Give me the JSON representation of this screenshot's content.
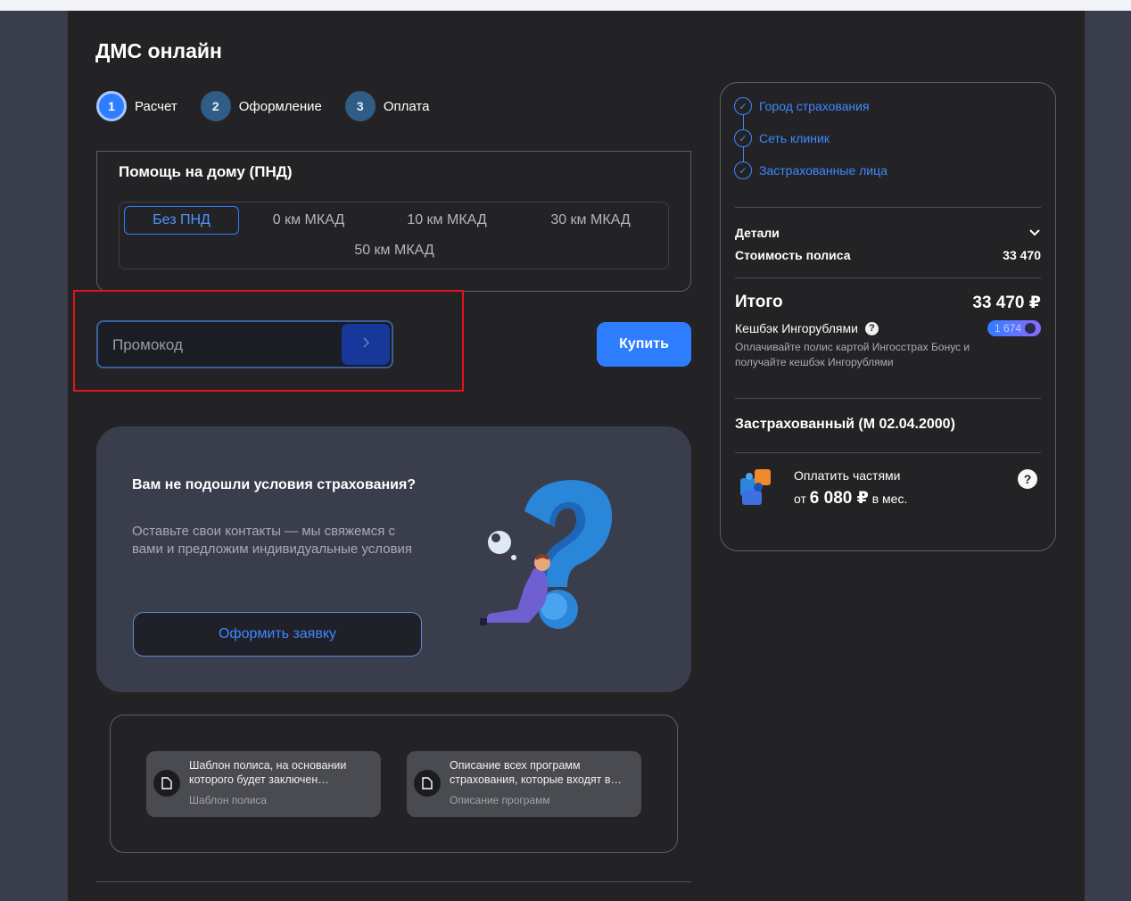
{
  "page": {
    "title": "ДМС онлайн"
  },
  "steps": [
    {
      "number": "1",
      "label": "Расчет",
      "active": true
    },
    {
      "number": "2",
      "label": "Оформление",
      "active": false
    },
    {
      "number": "3",
      "label": "Оплата",
      "active": false
    }
  ],
  "pnd": {
    "title": "Помощь на дому (ПНД)",
    "options": [
      "Без ПНД",
      "0 км МКАД",
      "10 км МКАД",
      "30 км МКАД",
      "50 км МКАД"
    ],
    "selected": "Без ПНД"
  },
  "promo": {
    "placeholder": "Промокод",
    "submit_icon": "chevron-right-icon"
  },
  "buy_button": "Купить",
  "help_card": {
    "title": "Вам не подошли условия страхования?",
    "text": "Оставьте свои контакты — мы свяжемся с вами и предложим индивидуальные условия",
    "button": "Оформить заявку"
  },
  "docs": [
    {
      "title": "Шаблон полиса, на основании которого будет заключен…",
      "subtitle": "Шаблон полиса"
    },
    {
      "title": "Описание всех программ страхования, которые входят в…",
      "subtitle": "Описание программ"
    }
  ],
  "summary": {
    "checklist": [
      "Город страхования",
      "Сеть клиник",
      "Застрахованные лица"
    ],
    "details_label": "Детали",
    "cost_label": "Стоимость полиса",
    "cost_value": "33 470",
    "total_label": "Итого",
    "total_value": "33 470 ₽",
    "cashback_label": "Кешбэк Ингорублями",
    "cashback_value": "1 674",
    "cashback_note": "Оплачивайте полис картой Ингосстрах Бонус и получайте кешбэк Ингорублями",
    "insured": "Застрахованный (М 02.04.2000)",
    "installments_title": "Оплатить частями",
    "installments_prefix": "от",
    "installments_amount": "6 080 ₽",
    "installments_suffix": "в мес."
  },
  "colors": {
    "accent": "#2f7dff",
    "background": "#232326",
    "highlight": "#e3131c"
  }
}
